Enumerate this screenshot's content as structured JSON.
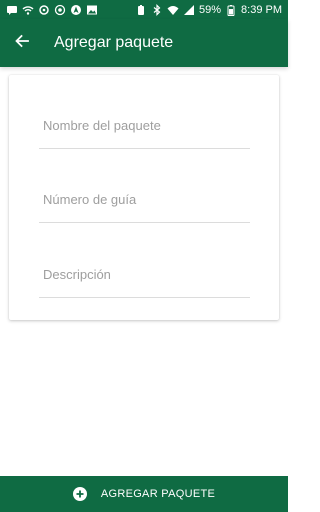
{
  "status_bar": {
    "battery_percent": "59%",
    "time": "8:39 PM",
    "left_icons": [
      "message-icon",
      "wifi-icon",
      "gear-icon",
      "target-icon",
      "navigation-icon",
      "image-icon"
    ],
    "right_icons": [
      "battery-saver-icon",
      "bluetooth-icon",
      "wifi-icon",
      "signal-icon",
      "battery-icon"
    ]
  },
  "app_bar": {
    "title": "Agregar paquete",
    "back_icon": "arrow-back-icon",
    "color": "#0f6b43"
  },
  "form": {
    "package_name_placeholder": "Nombre del paquete",
    "tracking_number_placeholder": "Número de guía",
    "description_placeholder": "Descripción"
  },
  "bottom_button": {
    "label": "AGREGAR PAQUETE",
    "icon": "add-circle-icon"
  }
}
